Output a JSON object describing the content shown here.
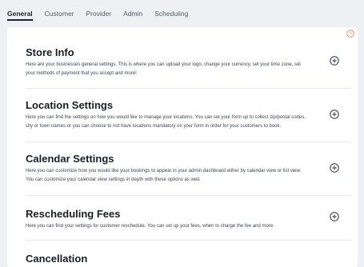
{
  "tabs": [
    {
      "label": "General",
      "active": true
    },
    {
      "label": "Customer",
      "active": false
    },
    {
      "label": "Provider",
      "active": false
    },
    {
      "label": "Admin",
      "active": false
    },
    {
      "label": "Scheduling",
      "active": false
    }
  ],
  "help_icon": "question-circle-icon",
  "accent_color": "#f08a4b",
  "sections": [
    {
      "title": "Store Info",
      "desc_line1": "Here are your businesses general settings. This is where you can upload your logo, change your currency, set your time zone, set",
      "desc_line2": "your methods of payment that you accept and more!",
      "icon": "plus-circle-icon"
    },
    {
      "title": "Location Settings",
      "desc_line1": "Here you can find the settings on how you would like to manage your locations. You can set your form up to collect zip/postal codes,",
      "desc_line2": "city or town names or you can choose to not have locations mandatory on your form in order for your customers to book.",
      "icon": "plus-circle-icon"
    },
    {
      "title": "Calendar Settings",
      "desc_line1": "Here you can customize how you would like your bookings to appear in your admin dashboard either by calendar view or list view.",
      "desc_line2": "You can customize your calendar view settings in depth with these options as well.",
      "icon": "plus-circle-icon"
    },
    {
      "title": "Rescheduling Fees",
      "desc_line1": "Here you can find your settings for customer reschedule. You can set up your fees, when to charge the fee and more.",
      "desc_line2": "",
      "icon": "plus-circle-icon"
    },
    {
      "title": "Cancellation",
      "desc_line1": "",
      "desc_line2": "",
      "icon": "plus-circle-icon"
    }
  ]
}
